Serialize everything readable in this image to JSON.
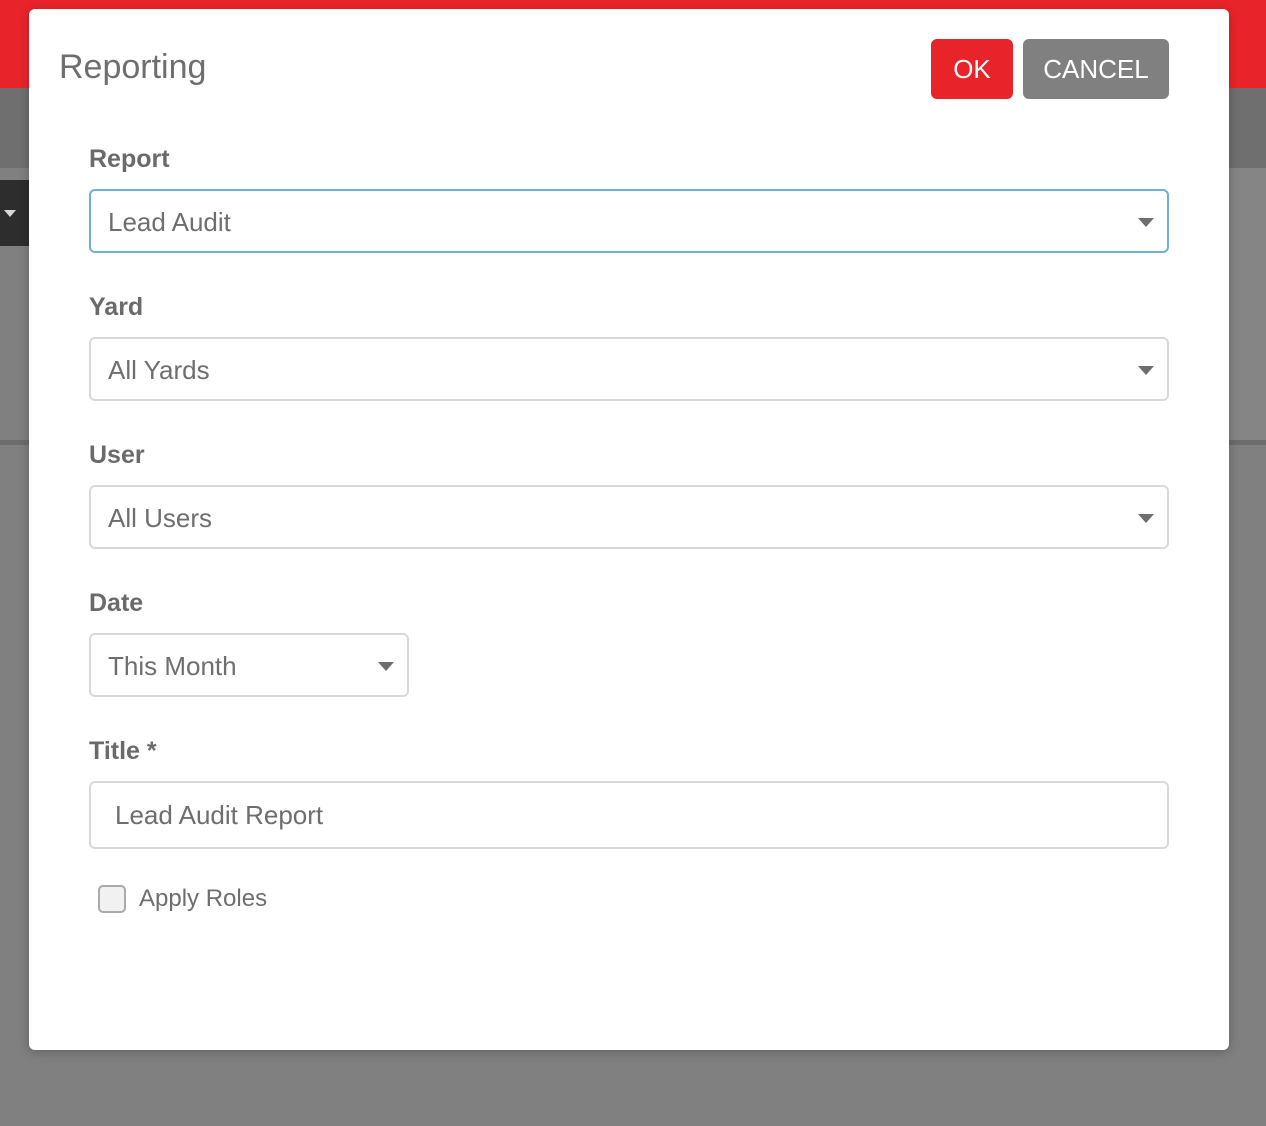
{
  "dialog": {
    "title": "Reporting",
    "ok_label": "OK",
    "cancel_label": "CANCEL"
  },
  "fields": {
    "report": {
      "label": "Report",
      "value": "Lead Audit"
    },
    "yard": {
      "label": "Yard",
      "value": "All Yards"
    },
    "user": {
      "label": "User",
      "value": "All Users"
    },
    "date": {
      "label": "Date",
      "value": "This Month"
    },
    "title": {
      "label": "Title *",
      "value": "Lead Audit Report"
    }
  },
  "apply_roles": {
    "label": "Apply Roles",
    "checked": false
  },
  "colors": {
    "brand_red": "#e8242a",
    "cancel_gray": "#808080",
    "focus_blue": "#6fb1d6",
    "overlay_gray": "#808080"
  },
  "icons": {
    "select_caret": "chevron-down-icon",
    "background_caret": "caret-down-icon"
  }
}
